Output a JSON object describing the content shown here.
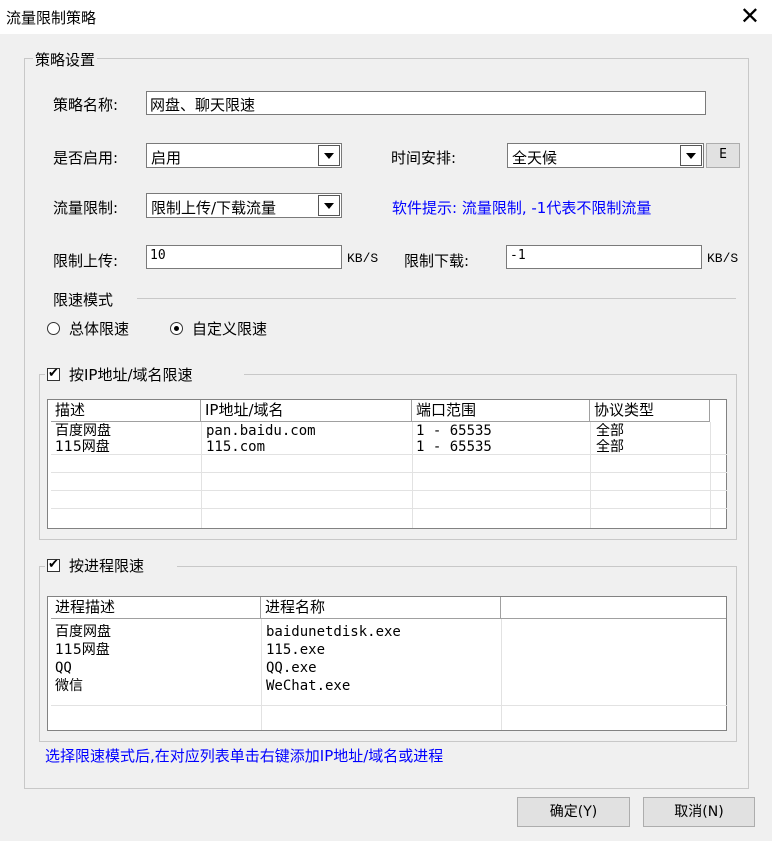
{
  "window": {
    "title": "流量限制策略"
  },
  "policy": {
    "legend": "策略设置",
    "name_label": "策略名称:",
    "name_value": "网盘、聊天限速",
    "enabled_label": "是否启用:",
    "enabled_value": "启用",
    "schedule_label": "时间安排:",
    "schedule_value": "全天候",
    "schedule_edit_button": "E",
    "limit_label": "流量限制:",
    "limit_value": "限制上传/下载流量",
    "hint": "软件提示: 流量限制, -1代表不限制流量",
    "upload_label": "限制上传:",
    "upload_value": "10",
    "upload_unit": "KB/S",
    "download_label": "限制下载:",
    "download_value": "-1",
    "download_unit": "KB/S"
  },
  "mode": {
    "legend": "限速模式",
    "options": [
      "总体限速",
      "自定义限速"
    ],
    "selected": "自定义限速"
  },
  "ip_section": {
    "label": "按IP地址/域名限速",
    "checked": true,
    "columns": [
      "描述",
      "IP地址/域名",
      "端口范围",
      "协议类型"
    ],
    "rows": [
      [
        "百度网盘",
        "pan.baidu.com",
        "1 - 65535",
        "全部"
      ],
      [
        "115网盘",
        "115.com",
        "1 - 65535",
        "全部"
      ]
    ]
  },
  "process_section": {
    "label": "按进程限速",
    "checked": true,
    "columns": [
      "进程描述",
      "进程名称"
    ],
    "rows": [
      [
        "百度网盘",
        "baidunetdisk.exe"
      ],
      [
        "115网盘",
        "115.exe"
      ],
      [
        "QQ",
        "QQ.exe"
      ],
      [
        "微信",
        "WeChat.exe"
      ]
    ]
  },
  "footer_hint": "选择限速模式后,在对应列表单击右键添加IP地址/域名或进程",
  "buttons": {
    "ok": "确定(Y)",
    "cancel": "取消(N)"
  },
  "colors": {
    "hint": "#0000ff",
    "background": "#f0f0f0"
  }
}
